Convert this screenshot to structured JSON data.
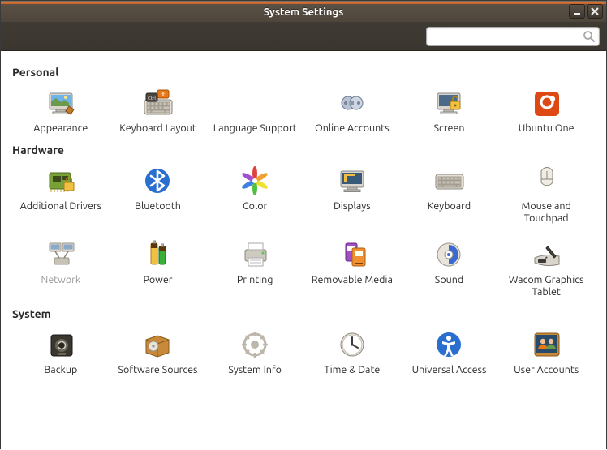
{
  "window": {
    "title": "System Settings"
  },
  "search": {
    "placeholder": ""
  },
  "sections": {
    "personal": {
      "header": "Personal",
      "items": [
        {
          "label": "Appearance",
          "icon": "appearance"
        },
        {
          "label": "Keyboard Layout",
          "icon": "keyboard-layout"
        },
        {
          "label": "Language Support",
          "icon": "language"
        },
        {
          "label": "Online Accounts",
          "icon": "online-accounts"
        },
        {
          "label": "Screen",
          "icon": "screen"
        },
        {
          "label": "Ubuntu One",
          "icon": "ubuntu-one"
        }
      ]
    },
    "hardware": {
      "header": "Hardware",
      "items": [
        {
          "label": "Additional Drivers",
          "icon": "drivers"
        },
        {
          "label": "Bluetooth",
          "icon": "bluetooth"
        },
        {
          "label": "Color",
          "icon": "color"
        },
        {
          "label": "Displays",
          "icon": "displays"
        },
        {
          "label": "Keyboard",
          "icon": "keyboard"
        },
        {
          "label": "Mouse and Touchpad",
          "icon": "mouse"
        },
        {
          "label": "Network",
          "icon": "network",
          "dim": true
        },
        {
          "label": "Power",
          "icon": "power"
        },
        {
          "label": "Printing",
          "icon": "printing"
        },
        {
          "label": "Removable Media",
          "icon": "removable-media"
        },
        {
          "label": "Sound",
          "icon": "sound"
        },
        {
          "label": "Wacom Graphics Tablet",
          "icon": "wacom"
        }
      ]
    },
    "system": {
      "header": "System",
      "items": [
        {
          "label": "Backup",
          "icon": "backup"
        },
        {
          "label": "Software Sources",
          "icon": "software-sources"
        },
        {
          "label": "System Info",
          "icon": "system-info"
        },
        {
          "label": "Time & Date",
          "icon": "time-date"
        },
        {
          "label": "Universal Access",
          "icon": "universal-access"
        },
        {
          "label": "User Accounts",
          "icon": "user-accounts"
        }
      ]
    }
  }
}
